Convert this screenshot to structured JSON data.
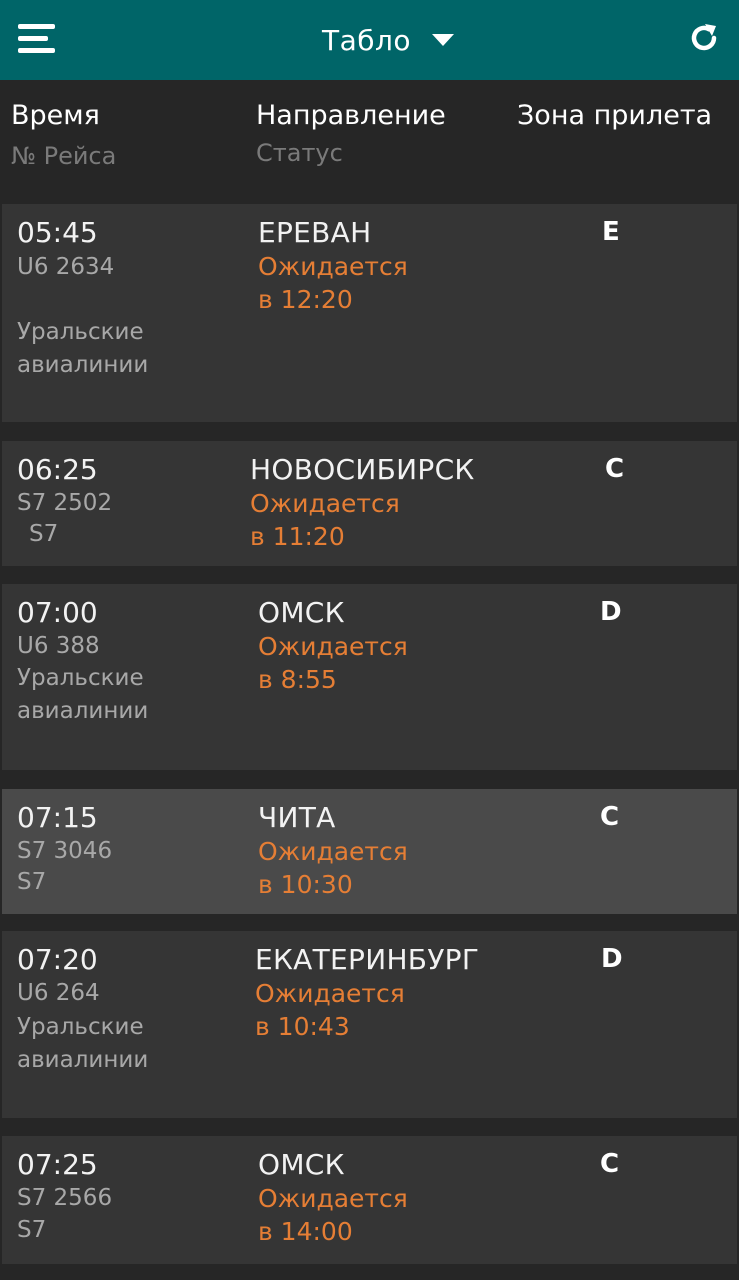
{
  "topbar": {
    "title": "Табло"
  },
  "header": {
    "time": "Время",
    "flight_no": "№ Рейса",
    "direction": "Направление",
    "status": "Статус",
    "zone": "Зона прилета"
  },
  "colors": {
    "topbar": "#006568",
    "status": "#E57E35",
    "row": "#353535",
    "row_selected": "#4A4A4A"
  },
  "flights": [
    {
      "time": "05:45",
      "flight": "U6 2634",
      "airline1": "Уральские",
      "airline2": "авиалинии",
      "dest": "ЕРЕВАН",
      "status1": "Ожидается",
      "status2": "в 12:20",
      "zone": "E"
    },
    {
      "time": "06:25",
      "flight": "S7 2502",
      "airline1": "S7",
      "airline2": "",
      "dest": "НОВОСИБИРСК",
      "status1": "Ожидается",
      "status2": "в 11:20",
      "zone": "C"
    },
    {
      "time": "07:00",
      "flight": "U6 388",
      "airline1": "Уральские",
      "airline2": "авиалинии",
      "dest": "ОМСК",
      "status1": "Ожидается",
      "status2": "в 8:55",
      "zone": "D"
    },
    {
      "time": "07:15",
      "flight": "S7 3046",
      "airline1": "S7",
      "airline2": "",
      "dest": "ЧИТА",
      "status1": "Ожидается",
      "status2": "в 10:30",
      "zone": "C"
    },
    {
      "time": "07:20",
      "flight": "U6 264",
      "airline1": "Уральские",
      "airline2": "авиалинии",
      "dest": "ЕКАТЕРИНБУРГ",
      "status1": "Ожидается",
      "status2": "в 10:43",
      "zone": "D"
    },
    {
      "time": "07:25",
      "flight": "S7 2566",
      "airline1": "S7",
      "airline2": "",
      "dest": "ОМСК",
      "status1": "Ожидается",
      "status2": "в 14:00",
      "zone": "C"
    }
  ]
}
